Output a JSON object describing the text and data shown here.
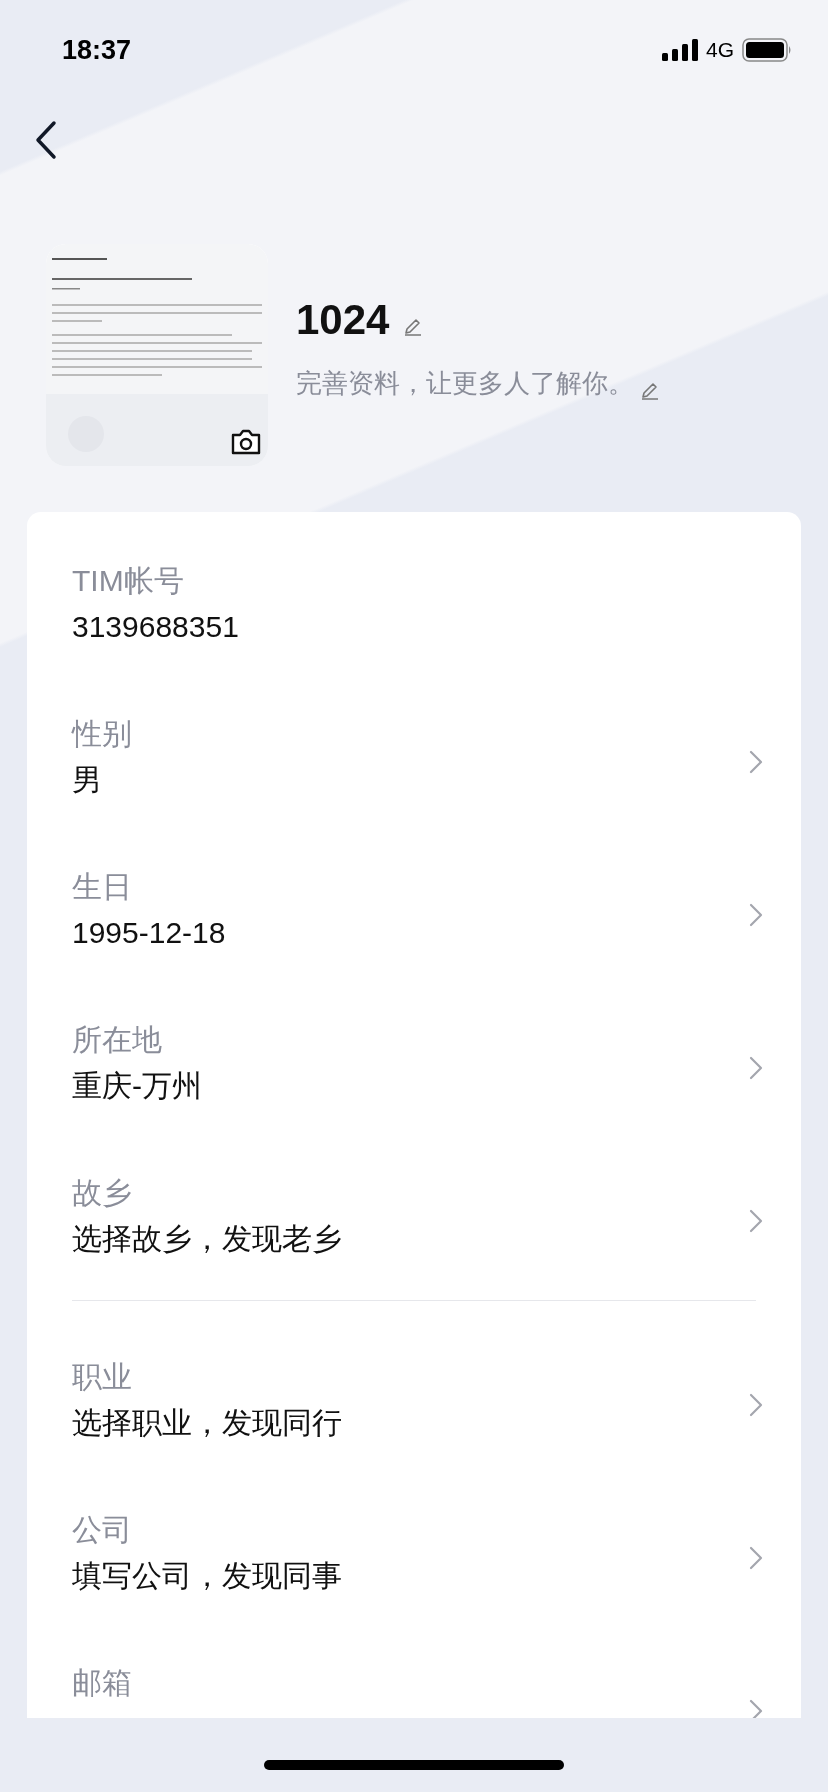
{
  "status_bar": {
    "time": "18:37",
    "network": "4G"
  },
  "profile": {
    "name": "1024",
    "bio": "完善资料，让更多人了解你。"
  },
  "sections": [
    {
      "items": [
        {
          "label": "TIM帐号",
          "value": "3139688351",
          "chevron": false
        },
        {
          "label": "性别",
          "value": "男",
          "chevron": true
        },
        {
          "label": "生日",
          "value": "1995-12-18",
          "chevron": true
        },
        {
          "label": "所在地",
          "value": "重庆-万州",
          "chevron": true
        },
        {
          "label": "故乡",
          "value": "选择故乡，发现老乡",
          "chevron": true
        }
      ]
    },
    {
      "items": [
        {
          "label": "职业",
          "value": "选择职业，发现同行",
          "chevron": true
        },
        {
          "label": "公司",
          "value": "填写公司，发现同事",
          "chevron": true
        },
        {
          "label": "邮箱",
          "chevron": true
        }
      ]
    }
  ]
}
